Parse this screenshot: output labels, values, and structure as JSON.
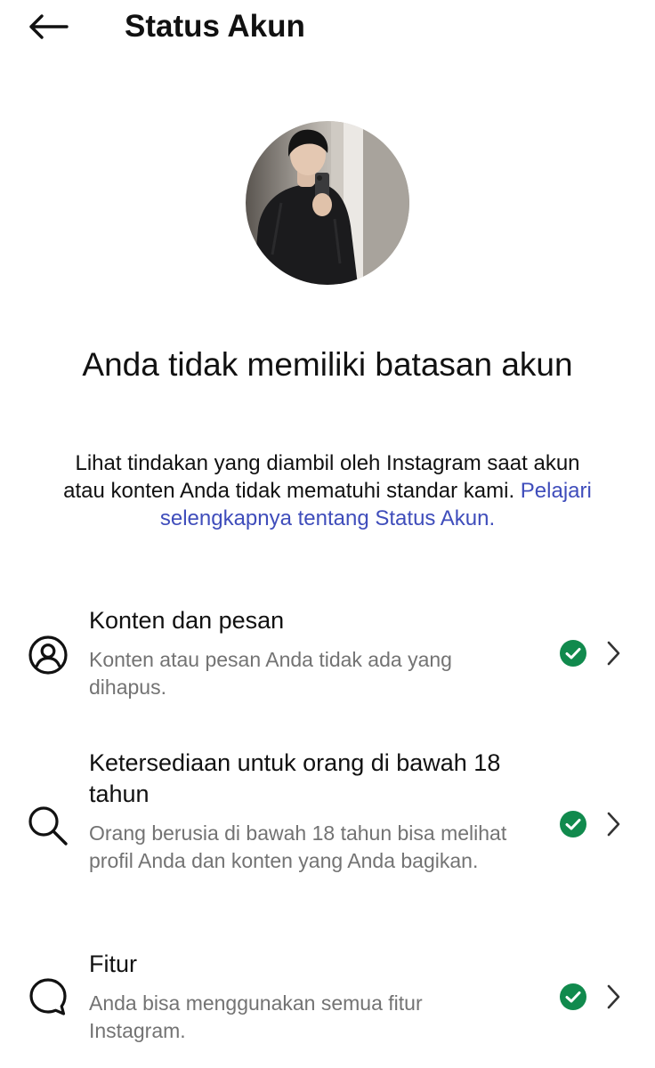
{
  "header": {
    "title": "Status Akun",
    "back_icon": "arrow-left-icon"
  },
  "profile": {
    "avatar_icon": "profile-photo"
  },
  "status": {
    "headline": "Anda tidak memiliki batasan akun",
    "description": "Lihat tindakan yang diambil oleh Instagram saat akun atau konten Anda tidak mematuhi standar kami.",
    "learn_more_link": "Pelajari selengkapnya tentang Status Akun."
  },
  "sections": [
    {
      "title": "Konten dan pesan",
      "subtitle": "Konten atau pesan Anda tidak ada yang dihapus.",
      "icon": "user-circle-icon",
      "status_icon": "check-circle-icon"
    },
    {
      "title": "Ketersediaan untuk orang di bawah 18 tahun",
      "subtitle": "Orang berusia di bawah 18 tahun bisa melihat profil Anda dan konten yang Anda bagikan.",
      "icon": "search-icon",
      "status_icon": "check-circle-icon"
    },
    {
      "title": "Fitur",
      "subtitle": "Anda bisa menggunakan semua fitur Instagram.",
      "icon": "chat-bubble-icon",
      "status_icon": "check-circle-icon"
    }
  ],
  "colors": {
    "link": "#3f4dbb",
    "check": "#118a4d",
    "secondary_text": "#737373"
  }
}
